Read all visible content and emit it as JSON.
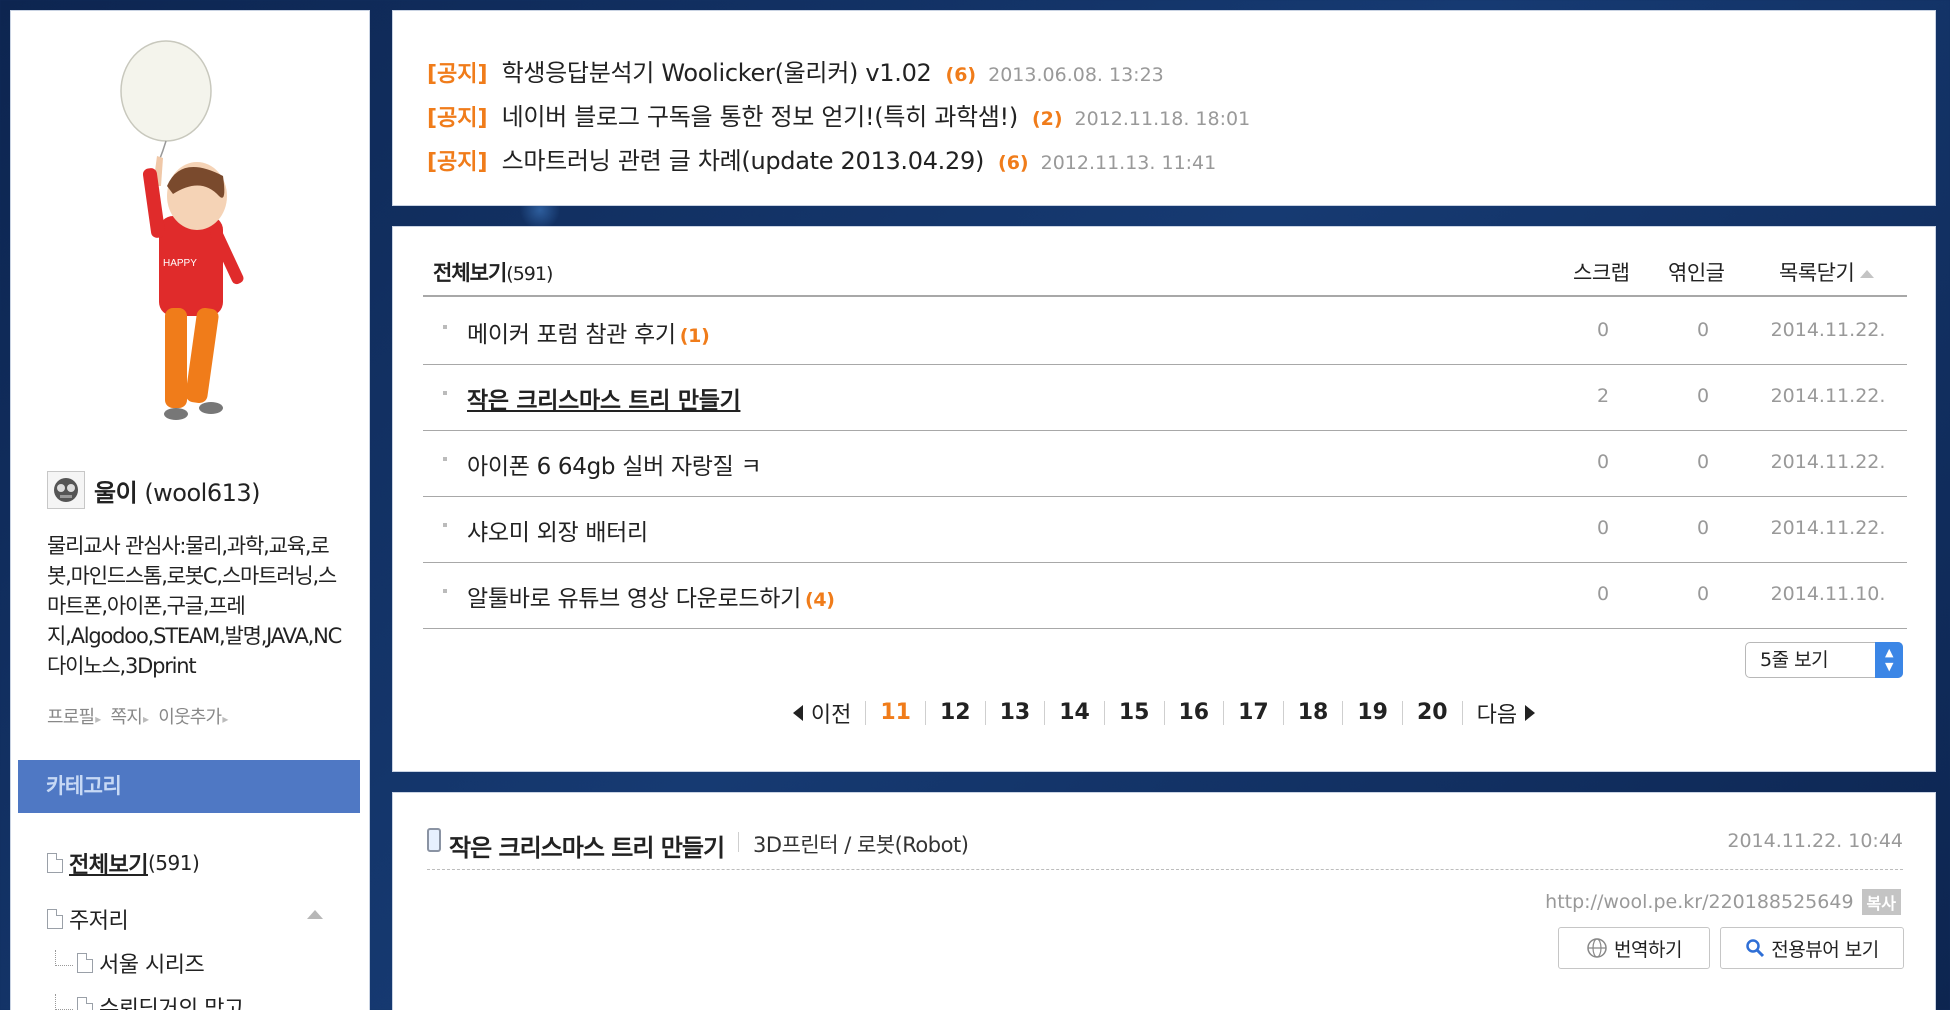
{
  "profile": {
    "name": "울이",
    "id": "(wool613)",
    "intro": "물리교사 관심사:물리,과학,교육,로봇,마인드스톰,로봇C,스마트러닝,스마트폰,아이폰,구글,프레지,Algodoo,STEAM,발명,JAVA,NC다이노스,3Dprint",
    "links": [
      "프로필",
      "쪽지",
      "이웃추가"
    ]
  },
  "category": {
    "header": "카테고리",
    "all_label": "전체보기 ",
    "all_count": "(591)",
    "items": [
      "주저리",
      "서울 시리즈",
      "슈뢰딩거의 망고"
    ]
  },
  "notices": [
    {
      "tag": "[공지]",
      "title": "학생응답분석기 Woolicker(울리커) v1.02",
      "count": "(6)",
      "date": "2013.06.08. 13:23"
    },
    {
      "tag": "[공지]",
      "title": "네이버 블로그 구독을 통한 정보 얻기!(특히 과학샘!)",
      "count": "(2)",
      "date": "2012.11.18. 18:01"
    },
    {
      "tag": "[공지]",
      "title": "스마트러닝 관련 글 차례(update 2013.04.29)",
      "count": "(6)",
      "date": "2012.11.13. 11:41"
    }
  ],
  "list": {
    "title": "전체보기",
    "count": "(591)",
    "columns": {
      "scrap": "스크랩",
      "reply": "엮인글",
      "close": "목록닫기"
    },
    "rows": [
      {
        "title": "메이커 포럼 참관 후기",
        "count": "(1)",
        "scrap": "0",
        "reply": "0",
        "date": "2014.11.22."
      },
      {
        "title": "작은 크리스마스 트리 만들기",
        "count": "",
        "scrap": "2",
        "reply": "0",
        "date": "2014.11.22."
      },
      {
        "title": "아이폰 6 64gb 실버 자랑질 ㅋ",
        "count": "",
        "scrap": "0",
        "reply": "0",
        "date": "2014.11.22."
      },
      {
        "title": "샤오미 외장 배터리",
        "count": "",
        "scrap": "0",
        "reply": "0",
        "date": "2014.11.22."
      },
      {
        "title": "알툴바로 유튜브 영상 다운로드하기",
        "count": "(4)",
        "scrap": "0",
        "reply": "0",
        "date": "2014.11.10."
      }
    ],
    "rows_select": "5줄 보기",
    "pagination": {
      "prev": "이전",
      "next": "다음",
      "pages": [
        "11",
        "12",
        "13",
        "14",
        "15",
        "16",
        "17",
        "18",
        "19",
        "20"
      ],
      "current": "11"
    }
  },
  "post": {
    "title": "작은 크리스마스 트리 만들기",
    "category": "3D프린터 / 로봇(Robot)",
    "date": "2014.11.22. 10:44",
    "url": "http://wool.pe.kr/220188525649",
    "copy_label": "복사",
    "translate_label": "번역하기",
    "viewer_label": "전용뷰어 보기"
  },
  "colors": {
    "accent_orange": "#f07c1a",
    "category_blue": "#4f78c4",
    "background_navy": "#0f2a55"
  }
}
